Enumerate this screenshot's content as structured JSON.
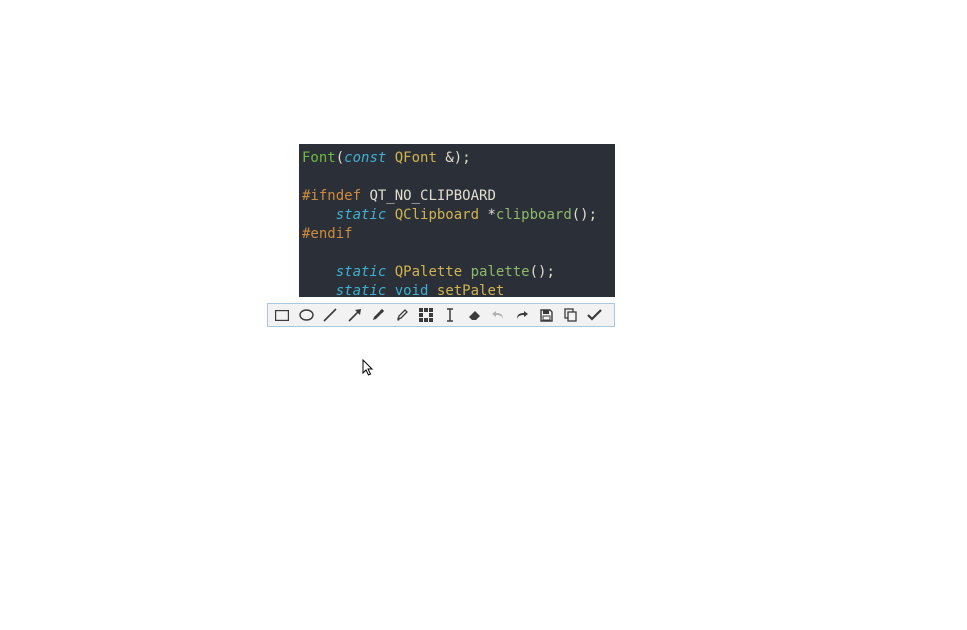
{
  "code": {
    "line1": {
      "t1": "Font",
      "t2": "(",
      "t3": "const",
      "t4": " ",
      "t5": "QFont",
      "t6": " &);"
    },
    "line3": {
      "t1": "#ifndef",
      "t2": " ",
      "t3": "QT_NO_CLIPBOARD"
    },
    "line4": {
      "t1": "    ",
      "t2": "static",
      "t3": " ",
      "t4": "QClipboard",
      "t5": " *",
      "t6": "clipboard",
      "t7": "();"
    },
    "line5": {
      "t1": "#endif"
    },
    "line7": {
      "t1": "    ",
      "t2": "static",
      "t3": " ",
      "t4": "QPalette",
      "t5": " ",
      "t6": "palette",
      "t7": "();"
    },
    "line8": {
      "t1": "    ",
      "t2": "static",
      "t3": " ",
      "t4": "void",
      "t5": " ",
      "t6": "setPalet"
    }
  },
  "toolbar": {
    "tools": [
      "rectangle",
      "ellipse",
      "line",
      "arrow",
      "pencil",
      "marker",
      "pixelate",
      "text",
      "eraser",
      "undo",
      "redo",
      "save",
      "copy",
      "ok"
    ]
  }
}
